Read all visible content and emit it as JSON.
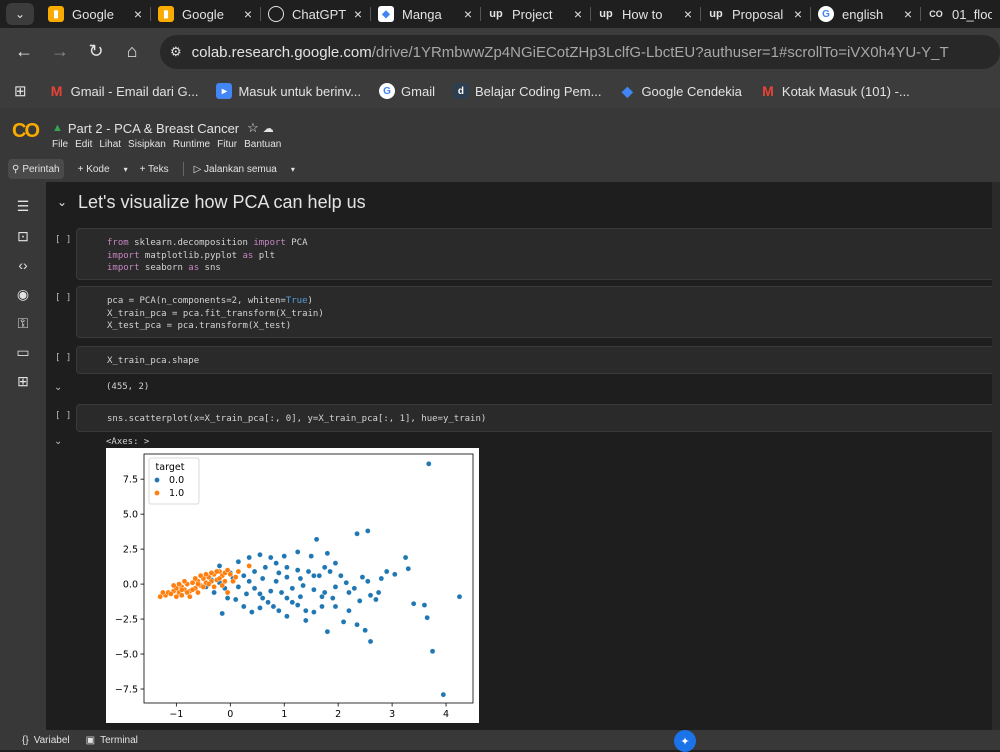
{
  "tabs": [
    {
      "title": "Google",
      "icon": "google-keep-icon",
      "color": "#f9ab00"
    },
    {
      "title": "Google",
      "icon": "google-keep-icon",
      "color": "#f9ab00"
    },
    {
      "title": "ChatGPT",
      "icon": "chatgpt-icon",
      "color": "#e3e3e3"
    },
    {
      "title": "Manga",
      "icon": "manga-icon",
      "color": "#4285f4"
    },
    {
      "title": "Project",
      "icon": "upwork-icon",
      "color": "#e3e3e3"
    },
    {
      "title": "How to",
      "icon": "upwork-icon",
      "color": "#e3e3e3"
    },
    {
      "title": "Proposal",
      "icon": "upwork-icon",
      "color": "#e3e3e3"
    },
    {
      "title": "english",
      "icon": "google-icon",
      "color": "#ffffff"
    },
    {
      "title": "01_floo",
      "icon": "colab-icon",
      "color": "#e3e3e3"
    }
  ],
  "tab_close": "×",
  "address": {
    "host": "colab.research.google.com",
    "path": "/drive/1YRmbwwZp4NGiECotZHp3LclfG-LbctEU?authuser=1#scrollTo=iVX0h4YU-Y_T"
  },
  "bookmarks": [
    {
      "label": "Gmail - Email dari G...",
      "icon": "gmail-icon",
      "color": "#ea4335"
    },
    {
      "label": "Masuk untuk berinv...",
      "icon": "bookmark-icon",
      "color": "#4285f4"
    },
    {
      "label": "Gmail",
      "icon": "google-icon",
      "color": "#ffffff"
    },
    {
      "label": "Belajar Coding Pem...",
      "icon": "dicoding-icon",
      "color": "#2d3e50"
    },
    {
      "label": "Google Cendekia",
      "icon": "scholar-icon",
      "color": "#4285f4"
    },
    {
      "label": "Kotak Masuk (101) -...",
      "icon": "gmail-icon",
      "color": "#ea4335"
    }
  ],
  "notebook": {
    "logo": "CO",
    "title": "Part 2 - PCA & Breast Cancer",
    "menus": [
      "File",
      "Edit",
      "Lihat",
      "Sisipkan",
      "Runtime",
      "Fitur",
      "Bantuan"
    ]
  },
  "commands": {
    "search": "Perintah",
    "add_code": "+ Kode",
    "add_text": "+ Teks",
    "run_all": "▷ Jalankan semua"
  },
  "section_title": "Let's visualize how PCA can help us",
  "cells": [
    {
      "run": "[ ]",
      "code": [
        "from sklearn.decomposition import PCA",
        "import matplotlib.pyplot as plt",
        "import seaborn as sns"
      ]
    },
    {
      "run": "[ ]",
      "code": [
        "pca = PCA(n_components=2, whiten=True)",
        "X_train_pca = pca.fit_transform(X_train)",
        "X_test_pca = pca.transform(X_test)"
      ]
    },
    {
      "run": "[ ]",
      "code": [
        "X_train_pca.shape"
      ],
      "output": "(455, 2)"
    },
    {
      "run": "[ ]",
      "code": [
        "sns.scatterplot(x=X_train_pca[:, 0], y=X_train_pca[:, 1], hue=y_train)"
      ],
      "output": "<Axes: >"
    }
  ],
  "bottom": {
    "variables": "Variabel",
    "terminal": "Terminal"
  },
  "colors": {
    "class0": "#1f77b4",
    "class1": "#ff7f0e"
  },
  "chart_data": {
    "type": "scatter",
    "title": "",
    "xlabel": "",
    "ylabel": "",
    "xlim": [
      -1.6,
      4.5
    ],
    "ylim": [
      -8.5,
      9.3
    ],
    "xticks": [
      -1,
      0,
      1,
      2,
      3,
      4
    ],
    "yticks": [
      7.5,
      5.0,
      2.5,
      0.0,
      -2.5,
      -5.0,
      -7.5
    ],
    "xtick_labels": [
      "−1",
      "0",
      "1",
      "2",
      "3",
      "4"
    ],
    "ytick_labels": [
      "7.5",
      "5.0",
      "2.5",
      "0.0",
      "−2.5",
      "−5.0",
      "−7.5"
    ],
    "legend": {
      "title": "target",
      "position": "top-left",
      "entries": [
        "0.0",
        "1.0"
      ]
    },
    "series": [
      {
        "name": "0.0",
        "points": [
          [
            3.68,
            8.6
          ],
          [
            2.35,
            3.6
          ],
          [
            2.55,
            3.8
          ],
          [
            3.25,
            1.9
          ],
          [
            3.3,
            1.1
          ],
          [
            2.9,
            0.9
          ],
          [
            3.4,
            -1.4
          ],
          [
            3.6,
            -1.5
          ],
          [
            3.65,
            -2.4
          ],
          [
            4.25,
            -0.9
          ],
          [
            3.75,
            -4.8
          ],
          [
            3.95,
            -7.9
          ],
          [
            2.5,
            -3.3
          ],
          [
            2.6,
            -4.1
          ],
          [
            1.8,
            -3.4
          ],
          [
            2.1,
            -2.7
          ],
          [
            2.35,
            -2.9
          ],
          [
            2.2,
            -1.9
          ],
          [
            1.95,
            -1.6
          ],
          [
            1.7,
            -1.6
          ],
          [
            1.55,
            -2.0
          ],
          [
            1.4,
            -1.9
          ],
          [
            1.25,
            -1.5
          ],
          [
            1.4,
            -2.6
          ],
          [
            1.3,
            -0.9
          ],
          [
            1.15,
            -1.3
          ],
          [
            1.05,
            -2.3
          ],
          [
            0.9,
            -1.9
          ],
          [
            0.8,
            -1.6
          ],
          [
            0.7,
            -1.3
          ],
          [
            0.55,
            -1.7
          ],
          [
            0.4,
            -2.0
          ],
          [
            0.25,
            -1.6
          ],
          [
            0.1,
            -1.1
          ],
          [
            -0.15,
            -2.1
          ],
          [
            -0.05,
            -1.0
          ],
          [
            0.3,
            -0.7
          ],
          [
            0.55,
            -0.7
          ],
          [
            0.75,
            -0.5
          ],
          [
            0.95,
            -0.6
          ],
          [
            1.15,
            -0.3
          ],
          [
            1.35,
            -0.1
          ],
          [
            1.55,
            -0.4
          ],
          [
            1.75,
            -0.6
          ],
          [
            1.95,
            -0.2
          ],
          [
            2.15,
            0.1
          ],
          [
            2.3,
            -0.3
          ],
          [
            2.45,
            0.5
          ],
          [
            2.05,
            0.6
          ],
          [
            1.85,
            0.9
          ],
          [
            1.65,
            0.6
          ],
          [
            1.45,
            0.9
          ],
          [
            1.25,
            1.0
          ],
          [
            1.05,
            1.2
          ],
          [
            0.85,
            1.5
          ],
          [
            0.65,
            1.2
          ],
          [
            0.45,
            0.9
          ],
          [
            0.25,
            0.6
          ],
          [
            0.05,
            0.4
          ],
          [
            -0.1,
            -0.3
          ],
          [
            0.15,
            -0.2
          ],
          [
            0.35,
            0.2
          ],
          [
            0.6,
            0.4
          ],
          [
            0.85,
            0.2
          ],
          [
            1.05,
            0.5
          ],
          [
            1.3,
            0.4
          ],
          [
            1.55,
            0.6
          ],
          [
            1.75,
            1.2
          ],
          [
            1.95,
            1.5
          ],
          [
            1.6,
            3.2
          ],
          [
            1.25,
            2.3
          ],
          [
            1.0,
            2.0
          ],
          [
            1.5,
            2.0
          ],
          [
            1.8,
            2.2
          ],
          [
            0.75,
            1.9
          ],
          [
            0.55,
            2.1
          ],
          [
            0.35,
            1.9
          ],
          [
            0.15,
            1.6
          ],
          [
            -0.2,
            1.3
          ],
          [
            -0.2,
            0.1
          ],
          [
            0.6,
            -1.0
          ],
          [
            1.9,
            -1.0
          ],
          [
            2.2,
            -0.6
          ],
          [
            2.4,
            -1.2
          ],
          [
            2.7,
            -1.1
          ],
          [
            2.75,
            -0.6
          ],
          [
            1.05,
            -1.0
          ],
          [
            0.45,
            -0.3
          ],
          [
            0.0,
            0.8
          ],
          [
            -0.35,
            0.3
          ],
          [
            -0.45,
            -0.2
          ],
          [
            -0.3,
            -0.6
          ],
          [
            0.9,
            0.8
          ],
          [
            1.7,
            -0.9
          ],
          [
            2.55,
            0.2
          ],
          [
            2.8,
            0.4
          ],
          [
            3.05,
            0.7
          ],
          [
            2.6,
            -0.8
          ]
        ]
      },
      {
        "name": "1.0",
        "points": [
          [
            -1.3,
            -0.9
          ],
          [
            -1.2,
            -0.8
          ],
          [
            -1.15,
            -0.6
          ],
          [
            -1.05,
            -0.5
          ],
          [
            -1.0,
            -0.3
          ],
          [
            -0.95,
            -0.6
          ],
          [
            -0.9,
            -0.2
          ],
          [
            -0.85,
            -0.4
          ],
          [
            -0.8,
            0.0
          ],
          [
            -0.75,
            -0.5
          ],
          [
            -0.7,
            0.1
          ],
          [
            -0.65,
            -0.3
          ],
          [
            -0.6,
            0.2
          ],
          [
            -0.55,
            -0.1
          ],
          [
            -0.5,
            0.4
          ],
          [
            -0.45,
            0.1
          ],
          [
            -0.4,
            0.5
          ],
          [
            -0.35,
            0.2
          ],
          [
            -0.3,
            0.7
          ],
          [
            -0.25,
            0.3
          ],
          [
            -0.2,
            0.9
          ],
          [
            -0.15,
            0.6
          ],
          [
            -0.1,
            0.8
          ],
          [
            -0.05,
            1.0
          ],
          [
            0.0,
            0.7
          ],
          [
            -1.25,
            -0.6
          ],
          [
            -1.1,
            -0.7
          ],
          [
            -1.0,
            -0.9
          ],
          [
            -0.9,
            -0.8
          ],
          [
            -0.8,
            -0.6
          ],
          [
            -0.7,
            -0.4
          ],
          [
            -0.6,
            -0.6
          ],
          [
            -0.5,
            -0.2
          ],
          [
            -0.4,
            0.0
          ],
          [
            -0.3,
            -0.2
          ],
          [
            -0.2,
            0.4
          ],
          [
            -0.1,
            0.2
          ],
          [
            0.05,
            0.2
          ],
          [
            0.1,
            0.5
          ],
          [
            -0.85,
            0.2
          ],
          [
            -0.65,
            0.4
          ],
          [
            -0.45,
            0.7
          ],
          [
            -0.25,
            0.9
          ],
          [
            0.35,
            1.3
          ],
          [
            -0.05,
            -0.6
          ],
          [
            -0.75,
            -0.9
          ],
          [
            -0.95,
            0.0
          ],
          [
            -1.05,
            -0.1
          ],
          [
            -0.55,
            0.6
          ],
          [
            -0.35,
            0.8
          ],
          [
            0.15,
            0.9
          ],
          [
            -0.15,
            -0.1
          ],
          [
            -0.6,
            0.0
          ],
          [
            -0.9,
            -0.4
          ]
        ]
      }
    ]
  }
}
